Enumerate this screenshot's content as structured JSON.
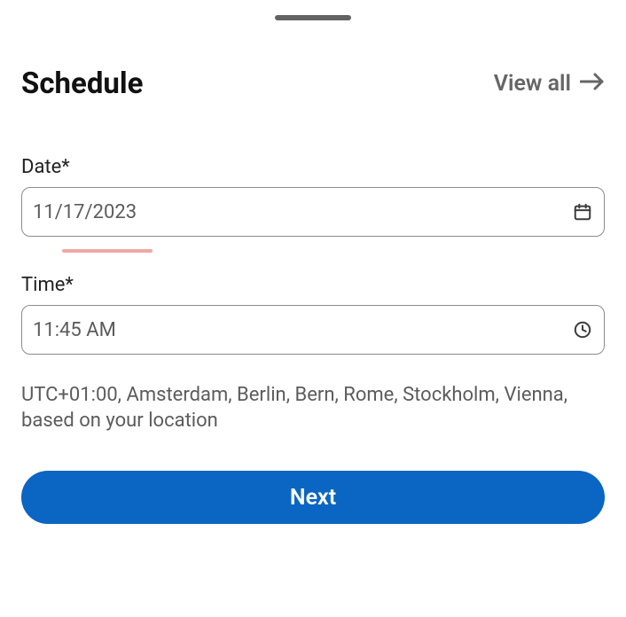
{
  "accent_color": "#0a66c2",
  "header": {
    "title": "Schedule",
    "view_all_label": "View all"
  },
  "date_field": {
    "label": "Date*",
    "value": "11/17/2023"
  },
  "time_field": {
    "label": "Time*",
    "value": "11:45 AM"
  },
  "timezone_helper": "UTC+01:00, Amsterdam, Berlin, Bern, Rome, Stockholm, Vienna, based on your location",
  "buttons": {
    "next": "Next"
  }
}
